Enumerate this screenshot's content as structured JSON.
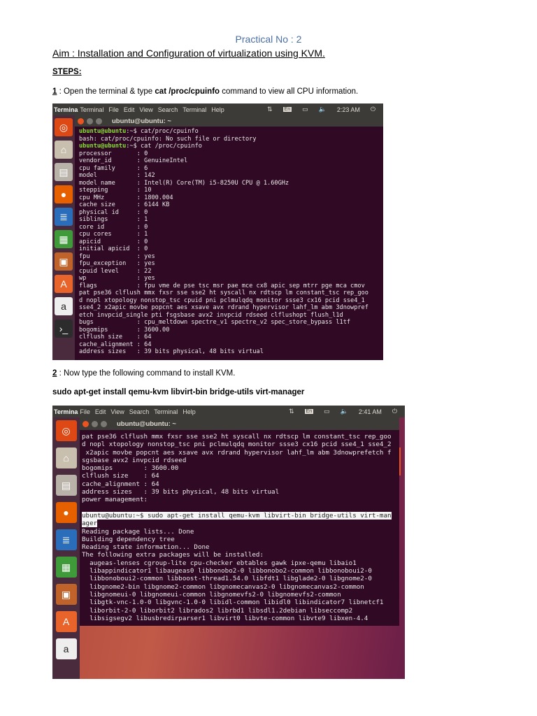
{
  "doc": {
    "title": "Practical No : 2",
    "aim": "Aim : Installation and Configuration of virtualization using KVM.",
    "steps_heading": "STEPS:",
    "step1": {
      "num": "1",
      "pre": " : Open the terminal & type ",
      "cmd": "cat /proc/cpuinfo",
      "post": " command to view all CPU information."
    },
    "step2": {
      "num": "2",
      "text": " : Now type the following command to install KVM."
    },
    "step2_cmd": "sudo apt-get install qemu-kvm libvirt-bin bridge-utils virt-manager"
  },
  "shot1": {
    "app": "Termina",
    "menu": [
      "Terminal",
      "File",
      "Edit",
      "View",
      "Search",
      "Terminal",
      "Help"
    ],
    "lang": "En",
    "clock": "2:23 AM",
    "window_title": "ubuntu@ubuntu: ~",
    "prompt": "ubuntu@ubuntu",
    "lines": [
      {
        "p": true,
        "t": ":~$ cat/proc/cpuinfo"
      },
      {
        "t": "bash: cat/proc/cpuinfo: No such file or directory"
      },
      {
        "p": true,
        "t": ":~$ cat /proc/cpuinfo"
      },
      {
        "t": "processor\t: 0"
      },
      {
        "t": "vendor_id\t: GenuineIntel"
      },
      {
        "t": "cpu family\t: 6"
      },
      {
        "t": "model\t\t: 142"
      },
      {
        "t": "model name\t: Intel(R) Core(TM) i5-8250U CPU @ 1.60GHz"
      },
      {
        "t": "stepping\t: 10"
      },
      {
        "t": "cpu MHz\t\t: 1800.004"
      },
      {
        "t": "cache size\t: 6144 KB"
      },
      {
        "t": "physical id\t: 0"
      },
      {
        "t": "siblings\t: 1"
      },
      {
        "t": "core id\t\t: 0"
      },
      {
        "t": "cpu cores\t: 1"
      },
      {
        "t": "apicid\t\t: 0"
      },
      {
        "t": "initial apicid\t: 0"
      },
      {
        "t": "fpu\t\t: yes"
      },
      {
        "t": "fpu_exception\t: yes"
      },
      {
        "t": "cpuid level\t: 22"
      },
      {
        "t": "wp\t\t: yes"
      },
      {
        "t": "flags\t\t: fpu vme de pse tsc msr pae mce cx8 apic sep mtrr pge mca cmov"
      },
      {
        "t": "pat pse36 clflush mmx fxsr sse sse2 ht syscall nx rdtscp lm constant_tsc rep_goo"
      },
      {
        "t": "d nopl xtopology nonstop_tsc cpuid pni pclmulqdq monitor ssse3 cx16 pcid sse4_1"
      },
      {
        "t": "sse4_2 x2apic movbe popcnt aes xsave avx rdrand hypervisor lahf_lm abm 3dnowpref"
      },
      {
        "t": "etch invpcid_single pti fsgsbase avx2 invpcid rdseed clflushopt flush_l1d"
      },
      {
        "t": "bugs\t\t: cpu_meltdown spectre_v1 spectre_v2 spec_store_bypass l1tf"
      },
      {
        "t": "bogomips\t: 3600.00"
      },
      {
        "t": "clflush size\t: 64"
      },
      {
        "t": "cache_alignment\t: 64"
      },
      {
        "t": "address sizes\t: 39 bits physical, 48 bits virtual"
      }
    ]
  },
  "shot2": {
    "app": "Termina",
    "menu": [
      "File",
      "Edit",
      "View",
      "Search",
      "Terminal",
      "Help"
    ],
    "lang": "En",
    "clock": "2:41 AM",
    "window_title": "ubuntu@ubuntu: ~",
    "lines": [
      {
        "t": "pat pse36 clflush mmx fxsr sse sse2 ht syscall nx rdtscp lm constant_tsc rep_goo"
      },
      {
        "t": "d nopl xtopology nonstop_tsc pni pclmulqdq monitor ssse3 cx16 pcid sse4_1 sse4_2"
      },
      {
        "t": " x2apic movbe popcnt aes xsave avx rdrand hypervisor lahf_lm abm 3dnowprefetch f"
      },
      {
        "t": "sgsbase avx2 invpcid rdseed"
      },
      {
        "t": "bogomips\t: 3600.00"
      },
      {
        "t": "clflush size\t: 64"
      },
      {
        "t": "cache_alignment\t: 64"
      },
      {
        "t": "address sizes\t: 39 bits physical, 48 bits virtual"
      },
      {
        "t": "power management:"
      },
      {
        "t": ""
      },
      {
        "h": true,
        "t": "ubuntu@ubuntu:~$ sudo apt-get install qemu-kvm libvirt-bin bridge-utils virt-man"
      },
      {
        "h": true,
        "t": "ager"
      },
      {
        "t": "Reading package lists... Done"
      },
      {
        "t": "Building dependency tree"
      },
      {
        "t": "Reading state information... Done"
      },
      {
        "t": "The following extra packages will be installed:"
      },
      {
        "t": "  augeas-lenses cgroup-lite cpu-checker ebtables gawk ipxe-qemu libaio1"
      },
      {
        "t": "  libappindicator1 libaugeas0 libbonobo2-0 libbonobo2-common libbonoboui2-0"
      },
      {
        "t": "  libbonoboui2-common libboost-thread1.54.0 libfdt1 libglade2-0 libgnome2-0"
      },
      {
        "t": "  libgnome2-bin libgnome2-common libgnomecanvas2-0 libgnomecanvas2-common"
      },
      {
        "t": "  libgnomeui-0 libgnomeui-common libgnomevfs2-0 libgnomevfs2-common"
      },
      {
        "t": "  libgtk-vnc-1.0-0 libgvnc-1.0-0 libidl-common libidl0 libindicator7 libnetcf1"
      },
      {
        "t": "  liborbit-2-0 liborbit2 librados2 librbd1 libsdl1.2debian libseccomp2"
      },
      {
        "t": "  libsigsegv2 libusbredirparser1 libvirt0 libvte-common libvte9 libxen-4.4"
      }
    ]
  },
  "launcher_icons": [
    "ubuntu-dash-icon",
    "files-icon",
    "file-cabinet-icon",
    "firefox-icon",
    "writer-icon",
    "calc-icon",
    "impress-icon",
    "software-center-icon",
    "amazon-icon",
    "terminal-icon"
  ]
}
